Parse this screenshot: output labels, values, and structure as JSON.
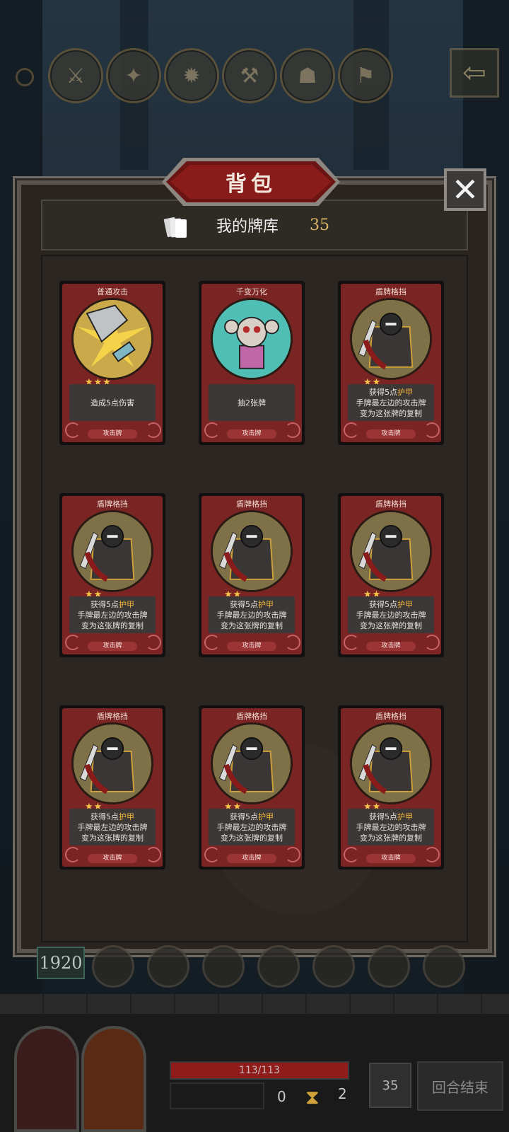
{
  "panel": {
    "title": "背包",
    "close_icon": "✕"
  },
  "deck": {
    "label": "我的牌库",
    "count": "35",
    "icon": "cards-icon"
  },
  "cards": [
    {
      "name": "普通攻击",
      "stars": "★★★",
      "desc_parts": [
        "造成5点伤害"
      ],
      "highlight": "",
      "type": "攻击牌",
      "art": "sword"
    },
    {
      "name": "千变万化",
      "stars": "",
      "desc_parts": [
        "抽2张牌"
      ],
      "highlight": "",
      "type": "攻击牌",
      "art": "spider"
    },
    {
      "name": "盾牌格挡",
      "stars": "★★",
      "desc_parts": [
        "获得5点",
        "手牌最左边的攻击牌",
        "变为这张牌的复制"
      ],
      "highlight": "护甲",
      "type": "攻击牌",
      "art": "knight"
    },
    {
      "name": "盾牌格挡",
      "stars": "★★",
      "desc_parts": [
        "获得5点",
        "手牌最左边的攻击牌",
        "变为这张牌的复制"
      ],
      "highlight": "护甲",
      "type": "攻击牌",
      "art": "knight"
    },
    {
      "name": "盾牌格挡",
      "stars": "★★",
      "desc_parts": [
        "获得5点",
        "手牌最左边的攻击牌",
        "变为这张牌的复制"
      ],
      "highlight": "护甲",
      "type": "攻击牌",
      "art": "knight"
    },
    {
      "name": "盾牌格挡",
      "stars": "★★",
      "desc_parts": [
        "获得5点",
        "手牌最左边的攻击牌",
        "变为这张牌的复制"
      ],
      "highlight": "护甲",
      "type": "攻击牌",
      "art": "knight"
    },
    {
      "name": "盾牌格挡",
      "stars": "★★",
      "desc_parts": [
        "获得5点",
        "手牌最左边的攻击牌",
        "变为这张牌的复制"
      ],
      "highlight": "护甲",
      "type": "攻击牌",
      "art": "knight"
    },
    {
      "name": "盾牌格挡",
      "stars": "★★",
      "desc_parts": [
        "获得5点",
        "手牌最左边的攻击牌",
        "变为这张牌的复制"
      ],
      "highlight": "护甲",
      "type": "攻击牌",
      "art": "knight"
    },
    {
      "name": "盾牌格挡",
      "stars": "★★",
      "desc_parts": [
        "获得5点",
        "手牌最左边的攻击牌",
        "变为这张牌的复制"
      ],
      "highlight": "护甲",
      "type": "攻击牌",
      "art": "knight"
    }
  ],
  "status": {
    "gold": "1920",
    "hp": "113/113",
    "block": "0",
    "energy": "2",
    "draw_pile": "35",
    "end_turn": "回合结束"
  },
  "icons": {
    "back": "back-arrow-icon",
    "hourglass": "hourglass-icon"
  }
}
